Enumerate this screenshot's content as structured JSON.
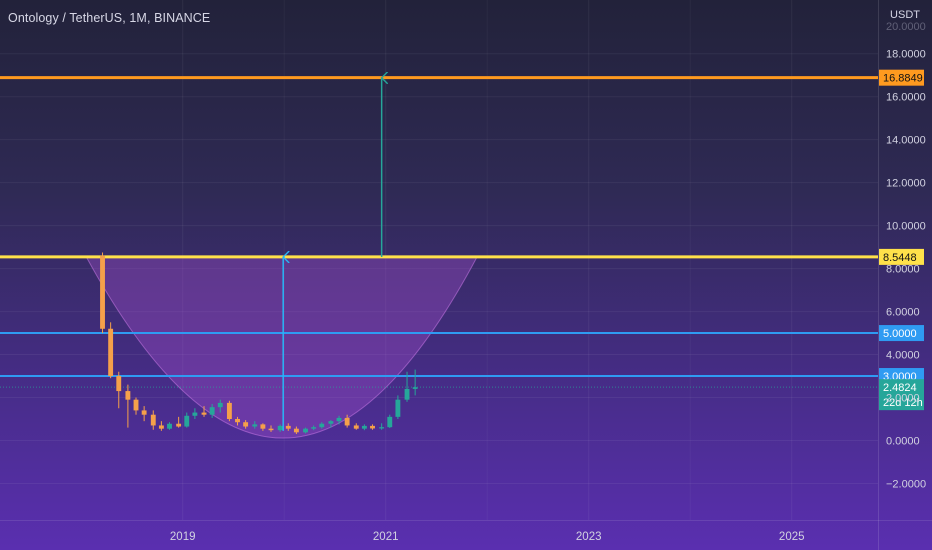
{
  "header": {
    "symbol_title": "Ontology / TetherUS, 1M, BINANCE",
    "currency": "USDT"
  },
  "chart_data": {
    "type": "candlestick",
    "y_ticks": [
      -2,
      0,
      2,
      4,
      6,
      8,
      10,
      12,
      14,
      16,
      18
    ],
    "y_tick_labels": [
      "−2.0000",
      "0.0000",
      "2.0000",
      "4.0000",
      "6.0000",
      "8.0000",
      "10.0000",
      "12.0000",
      "14.0000",
      "16.0000",
      "18.0000"
    ],
    "x_ticks": [
      2019,
      2021,
      2023,
      2025
    ],
    "x_tick_labels": [
      "2019",
      "2021",
      "2023",
      "2025"
    ],
    "ylim": [
      -3.7,
      20.5
    ],
    "xlim": [
      2017.2,
      2025.85
    ],
    "horizontal_lines": [
      {
        "value": 16.8849,
        "label": "16.8849",
        "color": "#ff9a1f"
      },
      {
        "value": 8.5448,
        "label": "8.5448",
        "color": "#ffe14a"
      },
      {
        "value": 5.0,
        "label": "5.0000",
        "color": "#2f9bf2"
      },
      {
        "value": 3.0,
        "label": "3.0000",
        "color": "#2f9bf2"
      }
    ],
    "last_price": {
      "value": 2.4824,
      "label": "2.4824",
      "countdown": "22d 12h",
      "color": "#26a69a"
    },
    "arrows": [
      {
        "x": 2019.99,
        "from": 0.45,
        "to": 8.54,
        "color": "#29b6f6"
      },
      {
        "x": 2020.96,
        "from": 8.54,
        "to": 16.88,
        "color": "#26a69a"
      }
    ],
    "cup": {
      "left_x": 2018.05,
      "bottom_x": 2020.0,
      "right_x": 2021.9,
      "top": 8.5448,
      "bottom": 0.3
    },
    "candles": [
      {
        "t": 2018.21,
        "o": 8.6,
        "h": 8.75,
        "l": 5.0,
        "c": 5.2
      },
      {
        "t": 2018.29,
        "o": 5.2,
        "h": 5.5,
        "l": 2.9,
        "c": 3.0
      },
      {
        "t": 2018.37,
        "o": 3.0,
        "h": 3.2,
        "l": 1.5,
        "c": 2.3
      },
      {
        "t": 2018.46,
        "o": 2.3,
        "h": 2.6,
        "l": 0.6,
        "c": 1.9
      },
      {
        "t": 2018.54,
        "o": 1.9,
        "h": 2.0,
        "l": 1.2,
        "c": 1.4
      },
      {
        "t": 2018.62,
        "o": 1.4,
        "h": 1.6,
        "l": 0.9,
        "c": 1.2
      },
      {
        "t": 2018.71,
        "o": 1.2,
        "h": 1.4,
        "l": 0.5,
        "c": 0.7
      },
      {
        "t": 2018.79,
        "o": 0.7,
        "h": 0.9,
        "l": 0.45,
        "c": 0.55
      },
      {
        "t": 2018.87,
        "o": 0.55,
        "h": 0.85,
        "l": 0.5,
        "c": 0.78
      },
      {
        "t": 2018.96,
        "o": 0.78,
        "h": 1.1,
        "l": 0.6,
        "c": 0.65
      },
      {
        "t": 2019.04,
        "o": 0.65,
        "h": 1.3,
        "l": 0.6,
        "c": 1.15
      },
      {
        "t": 2019.12,
        "o": 1.15,
        "h": 1.5,
        "l": 1.0,
        "c": 1.3
      },
      {
        "t": 2019.21,
        "o": 1.3,
        "h": 1.6,
        "l": 1.1,
        "c": 1.2
      },
      {
        "t": 2019.29,
        "o": 1.2,
        "h": 1.7,
        "l": 1.05,
        "c": 1.55
      },
      {
        "t": 2019.37,
        "o": 1.55,
        "h": 1.9,
        "l": 1.3,
        "c": 1.75
      },
      {
        "t": 2019.46,
        "o": 1.75,
        "h": 1.85,
        "l": 0.9,
        "c": 1.0
      },
      {
        "t": 2019.54,
        "o": 1.0,
        "h": 1.1,
        "l": 0.7,
        "c": 0.85
      },
      {
        "t": 2019.62,
        "o": 0.85,
        "h": 0.95,
        "l": 0.55,
        "c": 0.65
      },
      {
        "t": 2019.71,
        "o": 0.65,
        "h": 0.9,
        "l": 0.55,
        "c": 0.75
      },
      {
        "t": 2019.79,
        "o": 0.75,
        "h": 0.8,
        "l": 0.45,
        "c": 0.55
      },
      {
        "t": 2019.87,
        "o": 0.55,
        "h": 0.7,
        "l": 0.4,
        "c": 0.48
      },
      {
        "t": 2019.96,
        "o": 0.48,
        "h": 0.75,
        "l": 0.4,
        "c": 0.68
      },
      {
        "t": 2020.04,
        "o": 0.68,
        "h": 0.8,
        "l": 0.45,
        "c": 0.55
      },
      {
        "t": 2020.12,
        "o": 0.55,
        "h": 0.65,
        "l": 0.3,
        "c": 0.38
      },
      {
        "t": 2020.21,
        "o": 0.38,
        "h": 0.6,
        "l": 0.33,
        "c": 0.55
      },
      {
        "t": 2020.29,
        "o": 0.55,
        "h": 0.7,
        "l": 0.48,
        "c": 0.62
      },
      {
        "t": 2020.37,
        "o": 0.62,
        "h": 0.85,
        "l": 0.55,
        "c": 0.78
      },
      {
        "t": 2020.46,
        "o": 0.78,
        "h": 0.95,
        "l": 0.6,
        "c": 0.9
      },
      {
        "t": 2020.54,
        "o": 0.9,
        "h": 1.15,
        "l": 0.75,
        "c": 1.05
      },
      {
        "t": 2020.62,
        "o": 1.05,
        "h": 1.2,
        "l": 0.6,
        "c": 0.7
      },
      {
        "t": 2020.71,
        "o": 0.7,
        "h": 0.8,
        "l": 0.5,
        "c": 0.55
      },
      {
        "t": 2020.79,
        "o": 0.55,
        "h": 0.75,
        "l": 0.48,
        "c": 0.68
      },
      {
        "t": 2020.87,
        "o": 0.68,
        "h": 0.75,
        "l": 0.5,
        "c": 0.56
      },
      {
        "t": 2020.96,
        "o": 0.56,
        "h": 0.8,
        "l": 0.5,
        "c": 0.62
      },
      {
        "t": 2021.04,
        "o": 0.62,
        "h": 1.2,
        "l": 0.58,
        "c": 1.1
      },
      {
        "t": 2021.12,
        "o": 1.1,
        "h": 2.1,
        "l": 1.0,
        "c": 1.9
      },
      {
        "t": 2021.21,
        "o": 1.9,
        "h": 3.2,
        "l": 1.8,
        "c": 2.4
      },
      {
        "t": 2021.29,
        "o": 2.4,
        "h": 3.3,
        "l": 2.1,
        "c": 2.48
      }
    ]
  }
}
